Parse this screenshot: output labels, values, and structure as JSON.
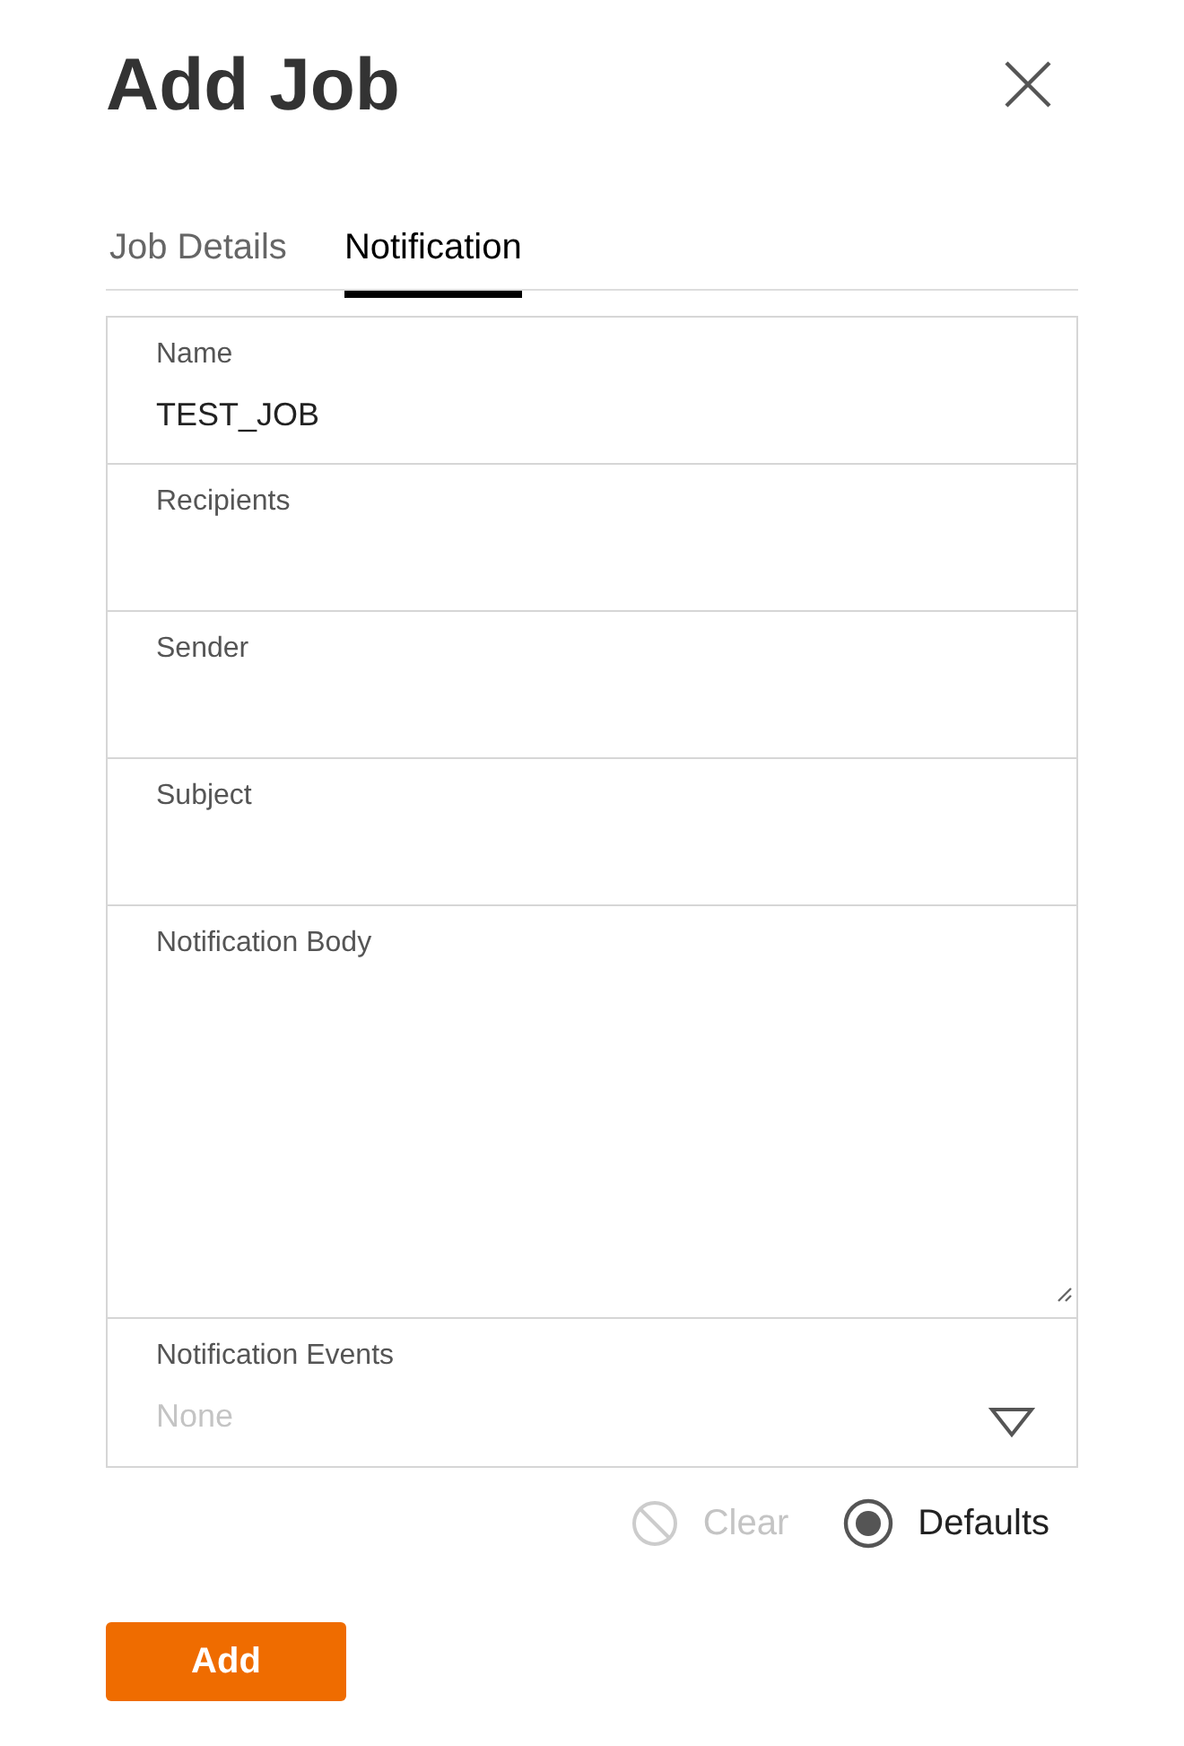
{
  "dialog": {
    "title": "Add Job"
  },
  "tabs": [
    {
      "label": "Job Details",
      "selected": false
    },
    {
      "label": "Notification",
      "selected": true
    }
  ],
  "fields": [
    {
      "kind": "text",
      "label": "Name",
      "value": "TEST_JOB"
    },
    {
      "kind": "text",
      "label": "Recipients"
    },
    {
      "kind": "text",
      "label": "Sender"
    },
    {
      "kind": "text",
      "label": "Subject"
    },
    {
      "kind": "textarea",
      "label": "Notification Body"
    },
    {
      "kind": "select",
      "label": "Notification Events",
      "placeholder": "None"
    }
  ],
  "actions": [
    {
      "kind": "clear",
      "label": "Clear",
      "disabled": true
    },
    {
      "kind": "radio",
      "label": "Defaults",
      "selected": true
    }
  ],
  "submit": {
    "label": "Add"
  }
}
